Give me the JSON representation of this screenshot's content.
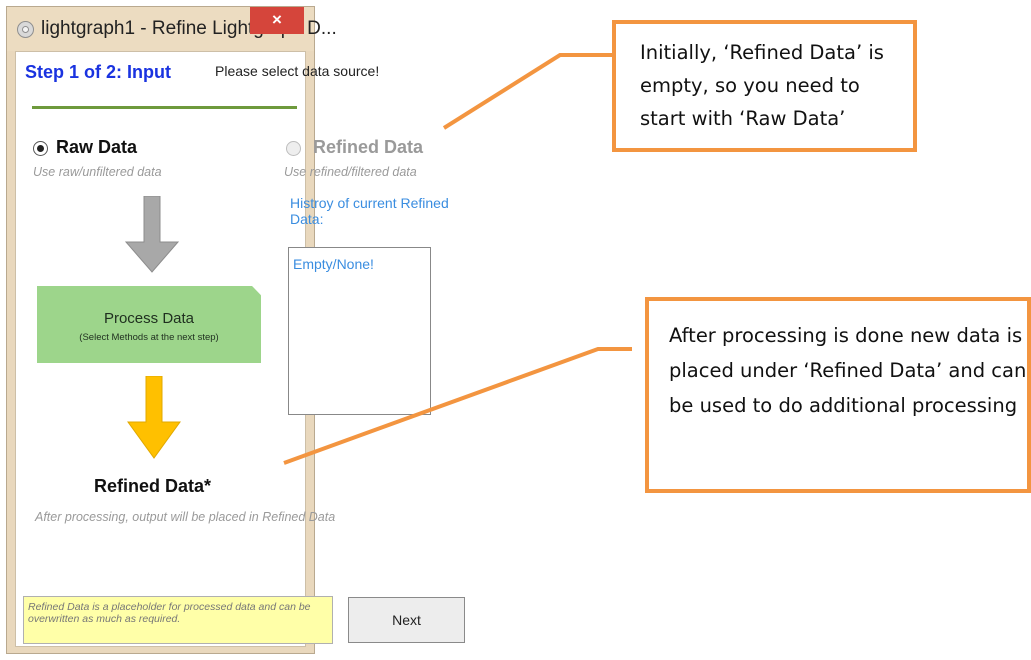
{
  "window": {
    "title": "lightgraph1 - Refine Lightgraph D...",
    "close_label": "×"
  },
  "step": {
    "title": "Step 1 of 2: Input",
    "instruction": "Please select data source!"
  },
  "options": {
    "raw": {
      "label": "Raw Data",
      "hint": "Use raw/unfiltered data",
      "selected": true
    },
    "refined": {
      "label": "Refined Data",
      "hint": "Use refined/filtered data",
      "selected": false,
      "enabled": false
    }
  },
  "history": {
    "title": "Histroy of current Refined Data:",
    "items": [
      "Empty/None!"
    ]
  },
  "process": {
    "title": "Process Data",
    "subtitle": "(Select Methods at the next step)"
  },
  "output": {
    "title": "Refined Data*",
    "hint": "After processing, output will be placed in Refined Data"
  },
  "note": "Refined Data is a placeholder for processed data and can be overwritten as much as required.",
  "buttons": {
    "next": "Next"
  },
  "callouts": {
    "top": "Initially, ‘Refined Data’ is empty, so you need to start with ‘Raw Data’",
    "bottom": "After processing is done new data is placed under ‘Refined Data’ and can be used to do additional processing"
  },
  "colors": {
    "step_title": "#1a33e0",
    "accent_line": "#6e9a3c",
    "history_text": "#3a8de0",
    "process_box": "#9dd58b",
    "callout_border": "#f39540",
    "close_button": "#d5453b",
    "arrow_gray": "#a8a8a8",
    "arrow_yellow": "#ffc000"
  }
}
